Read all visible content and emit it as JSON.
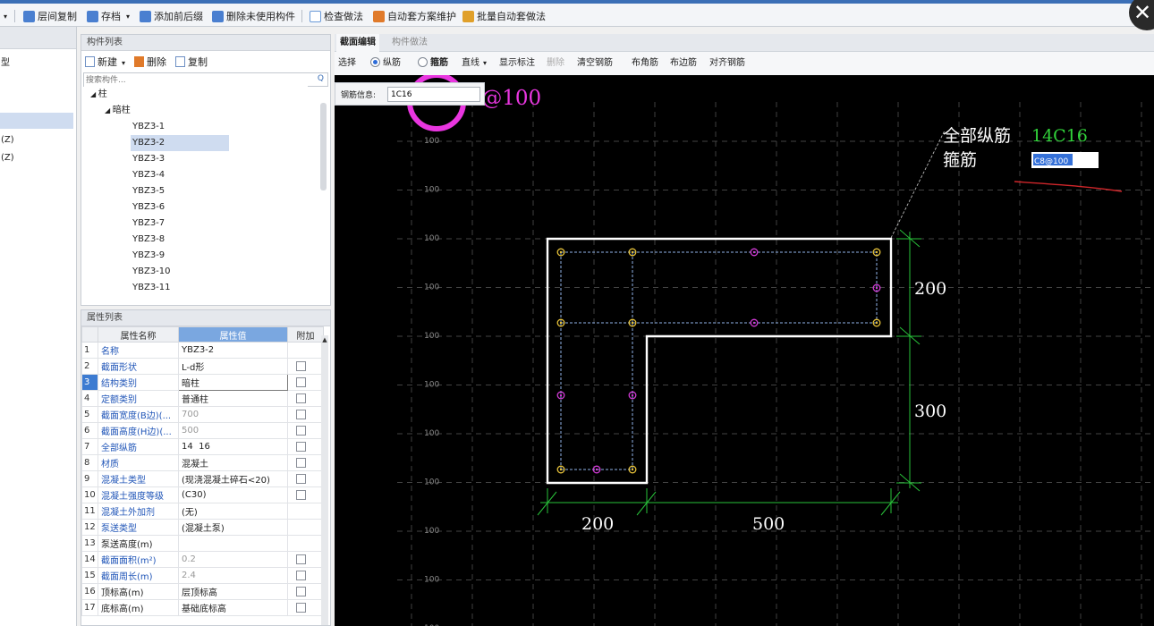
{
  "toolbar": {
    "items": [
      {
        "label": "层间复制",
        "icon": "layer-copy-icon",
        "color": "#4a7fd0"
      },
      {
        "label": "存档",
        "icon": "save-archive-icon",
        "color": "#4a7fd0"
      },
      {
        "label": "添加前后缀",
        "icon": "add-affix-icon",
        "color": "#4a7fd0"
      },
      {
        "label": "删除未使用构件",
        "icon": "delete-unused-icon",
        "color": "#4a7fd0"
      },
      {
        "label": "检查做法",
        "icon": "check-method-icon",
        "color": "#6a9ad8"
      },
      {
        "label": "自动套方案维护",
        "icon": "auto-scheme-icon",
        "color": "#e07a2a"
      },
      {
        "label": "批量自动套做法",
        "icon": "batch-auto-icon",
        "color": "#e0a02a"
      }
    ]
  },
  "left_stub": {
    "items": [
      "型",
      "(Z)",
      "(Z)"
    ]
  },
  "member_list": {
    "title": "构件列表",
    "new_label": "新建",
    "delete_label": "删除",
    "copy_label": "复制",
    "search_placeholder": "搜索构件...",
    "tree": {
      "root": "柱",
      "group": "暗柱",
      "items": [
        "YBZ3-1",
        "YBZ3-2",
        "YBZ3-3",
        "YBZ3-4",
        "YBZ3-5",
        "YBZ3-6",
        "YBZ3-7",
        "YBZ3-8",
        "YBZ3-9",
        "YBZ3-10",
        "YBZ3-11"
      ],
      "selected": "YBZ3-2"
    }
  },
  "properties": {
    "title": "属性列表",
    "headers": {
      "name": "属性名称",
      "value": "属性值",
      "extra": "附加"
    },
    "rows": [
      {
        "n": "1",
        "name": "名称",
        "value": "YBZ3-2",
        "blue": true,
        "grey": false,
        "check": false
      },
      {
        "n": "2",
        "name": "截面形状",
        "value": "L-d形",
        "blue": true,
        "grey": false,
        "check": true
      },
      {
        "n": "3",
        "name": "结构类别",
        "value": "暗柱",
        "blue": true,
        "grey": false,
        "check": true
      },
      {
        "n": "4",
        "name": "定额类别",
        "value": "普通柱",
        "blue": true,
        "grey": false,
        "check": true
      },
      {
        "n": "5",
        "name": "截面宽度(B边)(...",
        "value": "700",
        "blue": true,
        "grey": true,
        "check": true
      },
      {
        "n": "6",
        "name": "截面高度(H边)(...",
        "value": "500",
        "blue": true,
        "grey": true,
        "check": true
      },
      {
        "n": "7",
        "name": "全部纵筋",
        "value": "14  16",
        "blue": true,
        "grey": false,
        "check": true
      },
      {
        "n": "8",
        "name": "材质",
        "value": "混凝土",
        "blue": true,
        "grey": false,
        "check": true
      },
      {
        "n": "9",
        "name": "混凝土类型",
        "value": "(现浇混凝土碎石<20)",
        "blue": true,
        "grey": false,
        "check": true
      },
      {
        "n": "10",
        "name": "混凝土强度等级",
        "value": "(C30)",
        "blue": true,
        "grey": false,
        "check": true
      },
      {
        "n": "11",
        "name": "混凝土外加剂",
        "value": "(无)",
        "blue": true,
        "grey": false,
        "check": false
      },
      {
        "n": "12",
        "name": "泵送类型",
        "value": "(混凝土泵)",
        "blue": true,
        "grey": false,
        "check": false
      },
      {
        "n": "13",
        "name": "泵送高度(m)",
        "value": "",
        "blue": false,
        "grey": false,
        "check": false
      },
      {
        "n": "14",
        "name": "截面面积(m²)",
        "value": "0.2",
        "blue": true,
        "grey": true,
        "check": true
      },
      {
        "n": "15",
        "name": "截面周长(m)",
        "value": "2.4",
        "blue": true,
        "grey": true,
        "check": true
      },
      {
        "n": "16",
        "name": "顶标高(m)",
        "value": "层顶标高",
        "blue": false,
        "grey": false,
        "check": true
      },
      {
        "n": "17",
        "name": "底标高(m)",
        "value": "基础底标高",
        "blue": false,
        "grey": false,
        "check": true
      }
    ],
    "selected_row": "3"
  },
  "editor": {
    "tabs": [
      "截面编辑",
      "构件做法"
    ],
    "toolbar": {
      "select": "选择",
      "longitudinal": "纵筋",
      "stirrup": "箍筋",
      "line": "直线",
      "show_label": "显示标注",
      "delete": "删除",
      "clear": "清空钢筋",
      "corner": "布角筋",
      "edge": "布边筋",
      "align": "对齐钢筋"
    },
    "rebar_info_label": "钢筋信息:",
    "rebar_info_value": "1C16",
    "overlay_text": "C8@100",
    "grid_labels": [
      "100",
      "100",
      "100",
      "100",
      "100",
      "100",
      "100",
      "100",
      "100",
      "100",
      "100"
    ],
    "annotation": {
      "longitudinal_label": "全部纵筋",
      "longitudinal_value": "14C16",
      "stirrup_label": "箍筋",
      "stirrup_value": "C8@100"
    },
    "dimensions": {
      "left_height": "200",
      "right_height": "300",
      "bottom_left": "200",
      "bottom_right": "500"
    },
    "colors": {
      "outline": "#ffffff",
      "dimension": "#29c23a",
      "corner_rebar": "#e8c33a",
      "edge_rebar": "#d23ad6",
      "stirrup": "#8fb2e8",
      "highlight_circle": "#e936e0",
      "annotation_value": "#31d23a",
      "red_mark": "#d0262a"
    }
  }
}
